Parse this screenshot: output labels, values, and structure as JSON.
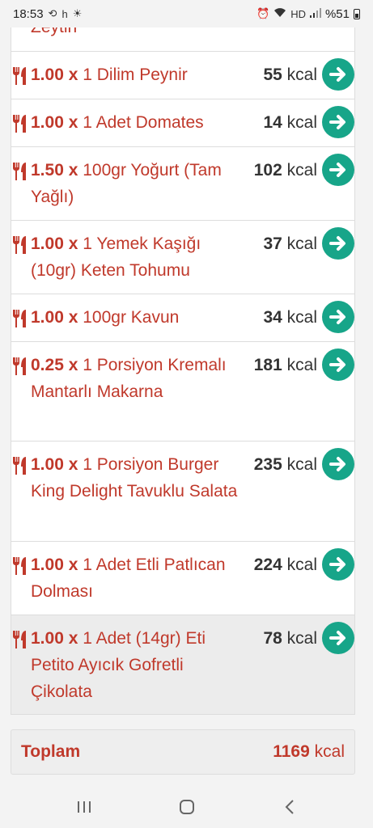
{
  "status": {
    "time": "18:53",
    "notif_text": "h",
    "battery": "%51"
  },
  "partial_item": "Zeytin",
  "items": [
    {
      "qty": "1.00 x",
      "name": "1 Dilim Peynir",
      "kcal": "55",
      "unit": "kcal"
    },
    {
      "qty": "1.00 x",
      "name": "1 Adet Domates",
      "kcal": "14",
      "unit": "kcal"
    },
    {
      "qty": "1.50 x",
      "name": "100gr Yoğurt (Tam Yağlı)",
      "kcal": "102",
      "unit": "kcal"
    },
    {
      "qty": "1.00 x",
      "name": "1 Yemek Kaşığı (10gr) Keten Tohumu",
      "kcal": "37",
      "unit": "kcal"
    },
    {
      "qty": "1.00 x",
      "name": "100gr Kavun",
      "kcal": "34",
      "unit": "kcal"
    },
    {
      "qty": "0.25 x",
      "name": "1 Porsiyon Kremalı Mantarlı Makarna",
      "kcal": "181",
      "unit": "kcal"
    },
    {
      "qty": "1.00 x",
      "name": "1 Porsiyon Burger King Delight Tavuklu Salata",
      "kcal": "235",
      "unit": "kcal"
    },
    {
      "qty": "1.00 x",
      "name": "1 Adet Etli Patlıcan Dolması",
      "kcal": "224",
      "unit": "kcal"
    },
    {
      "qty": "1.00 x",
      "name": "1 Adet (14gr) Eti Petito Ayıcık Gofretli Çikolata",
      "kcal": "78",
      "unit": "kcal"
    }
  ],
  "total": {
    "label": "Toplam",
    "value": "1169",
    "unit": "kcal"
  },
  "colors": {
    "accent_red": "#c0392b",
    "arrow_green": "#17a589"
  }
}
